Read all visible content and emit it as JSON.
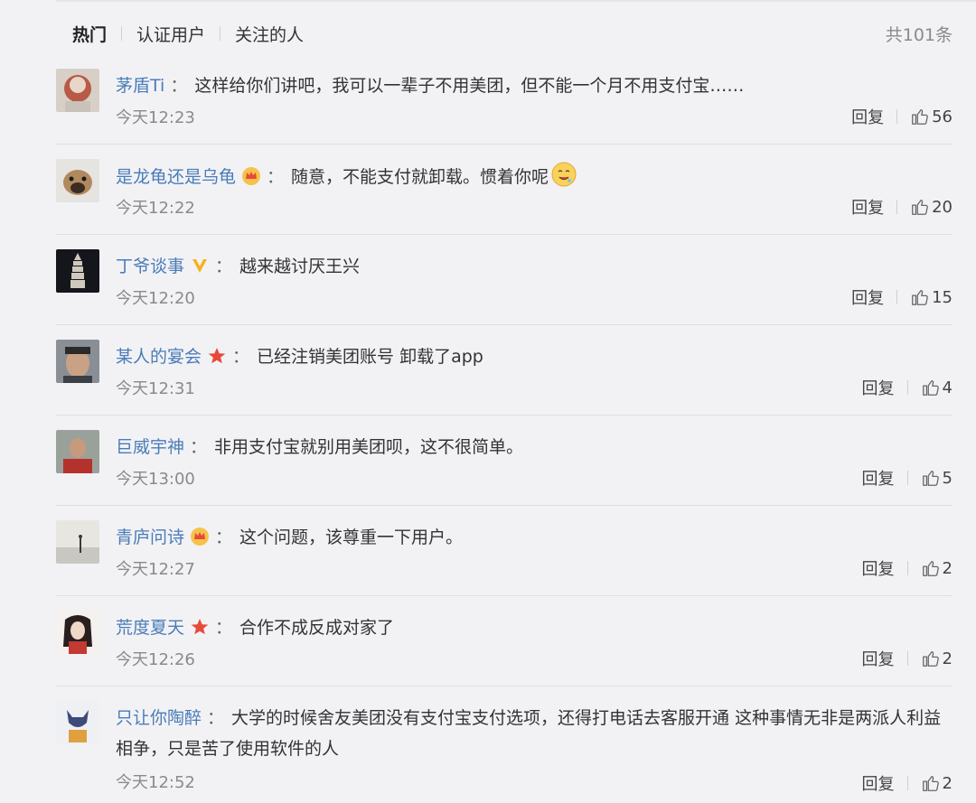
{
  "tabs": [
    {
      "label": "热门",
      "active": true
    },
    {
      "label": "认证用户",
      "active": false
    },
    {
      "label": "关注的人",
      "active": false
    }
  ],
  "total_label": "共101条",
  "reply_label": "回复",
  "colors": {
    "name": "#4a7cb8",
    "meta": "#8a8a8a",
    "background": "#f2f2f5"
  },
  "comments": [
    {
      "user": "茅盾Ti",
      "badge": "",
      "text": "这样给你们讲吧，我可以一辈子不用美团，但不能一个月不用支付宝……",
      "time": "今天12:23",
      "likes": "56"
    },
    {
      "user": "是龙龟还是乌龟",
      "badge": "crown-badge-icon",
      "text": "随意，不能支付就卸载。惯着你呢",
      "emoji": "drooling-face-emoji",
      "time": "今天12:22",
      "likes": "20"
    },
    {
      "user": "丁爷谈事",
      "badge": "verified-v-icon",
      "text": "越来越讨厌王兴",
      "time": "今天12:20",
      "likes": "15"
    },
    {
      "user": "某人的宴会",
      "badge": "star-badge-icon",
      "text": "已经注销美团账号 卸载了app",
      "time": "今天12:31",
      "likes": "4"
    },
    {
      "user": "巨威宇神",
      "badge": "",
      "text": "非用支付宝就别用美团呗，这不很简单。",
      "time": "今天13:00",
      "likes": "5"
    },
    {
      "user": "青庐问诗",
      "badge": "crown-badge-icon",
      "text": "这个问题，该尊重一下用户。",
      "time": "今天12:27",
      "likes": "2"
    },
    {
      "user": "荒度夏天",
      "badge": "star-badge-icon",
      "text": "合作不成反成对家了",
      "time": "今天12:26",
      "likes": "2"
    },
    {
      "user": "只让你陶醉",
      "badge": "",
      "text": "大学的时候舍友美团没有支付宝支付选项，还得打电话去客服开通 这种事情无非是两派人利益相争，只是苦了使用软件的人",
      "time": "今天12:52",
      "likes": "2"
    }
  ]
}
